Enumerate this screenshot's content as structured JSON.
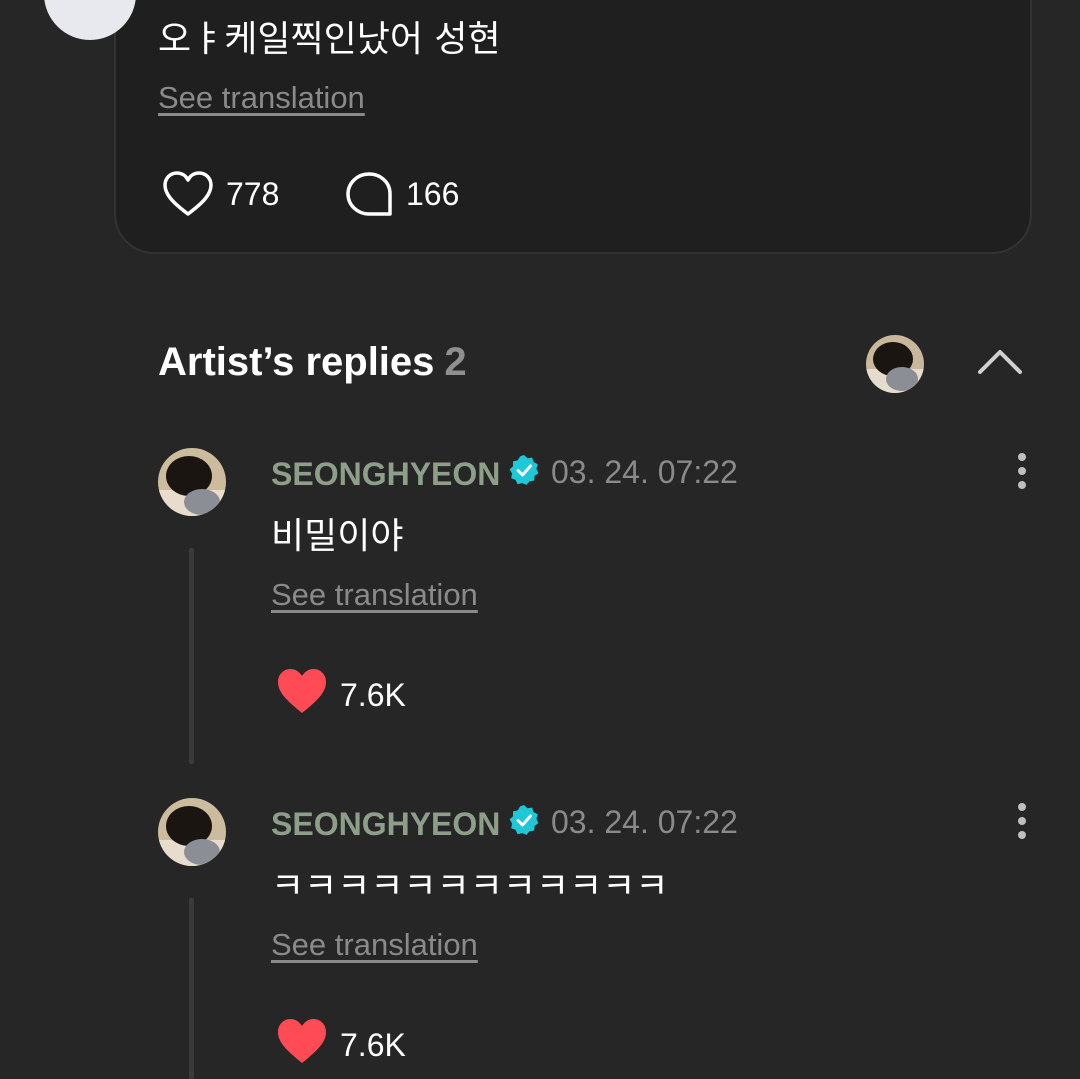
{
  "post": {
    "text": "오ㅑ케일찍인났어 성현",
    "translate_label": "See translation",
    "likes": "778",
    "comments": "166"
  },
  "replies_section": {
    "title": "Artist’s replies",
    "count": "2"
  },
  "replies": [
    {
      "author": "SEONGHYEON",
      "timestamp": "03. 24. 07:22",
      "text": "비밀이야",
      "translate_label": "See translation",
      "likes": "7.6K"
    },
    {
      "author": "SEONGHYEON",
      "timestamp": "03. 24. 07:22",
      "text": "ㅋㅋㅋㅋㅋㅋㅋㅋㅋㅋㅋㅋ",
      "translate_label": "See translation",
      "likes": "7.6K"
    }
  ],
  "icons": {
    "like_outline": "heart-outline-icon",
    "comment": "speech-bubble-icon",
    "like_filled": "heart-filled-icon",
    "verified": "verified-badge-icon",
    "more": "more-vertical-icon",
    "collapse": "chevron-up-icon"
  },
  "colors": {
    "background": "#262626",
    "card": "#1f1f1f",
    "artist_name": "#8d9f88",
    "verified": "#1ec8d6",
    "heart": "#ff4b55",
    "muted": "#8a8a8a"
  }
}
